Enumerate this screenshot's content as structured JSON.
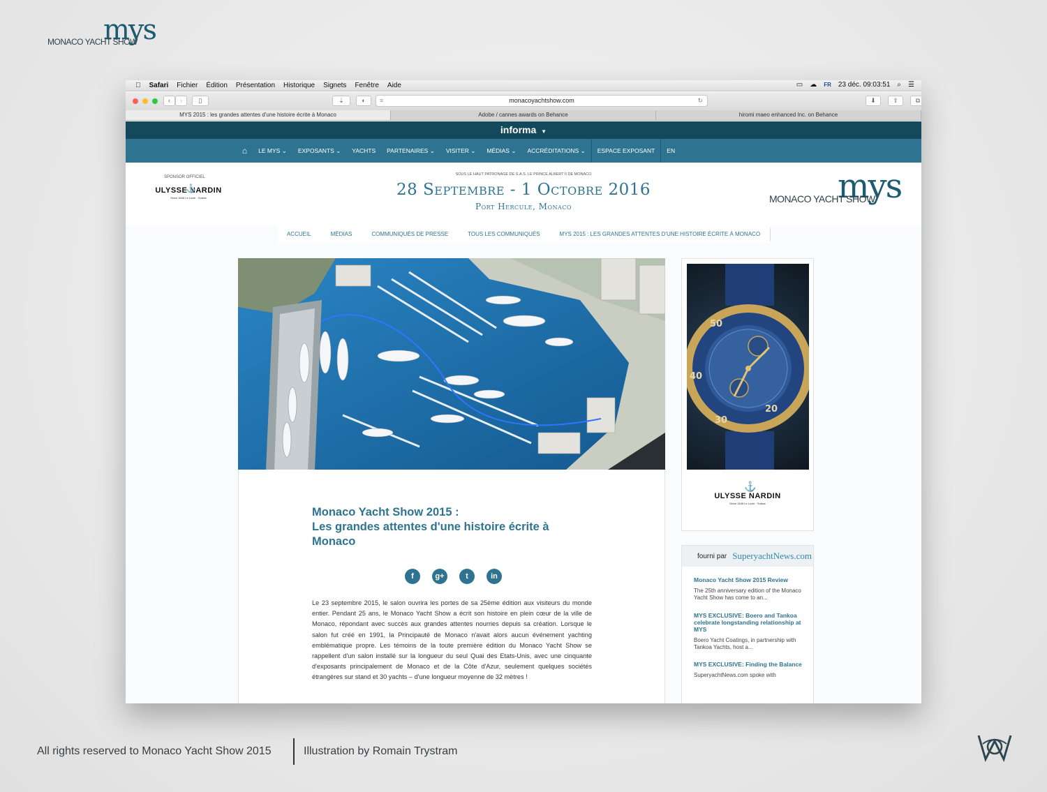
{
  "presentation": {
    "logo_script": "mys",
    "logo_text": "MONACO YACHT SHOW",
    "footer_left": "All rights reserved to Monaco Yacht Show 2015",
    "footer_right": "Illustration by Romain Trystram"
  },
  "menubar": {
    "items": [
      "Safari",
      "Fichier",
      "Édition",
      "Présentation",
      "Historique",
      "Signets",
      "Fenêtre",
      "Aide"
    ],
    "flag": "FR",
    "clock": "23 déc.  09:03:51"
  },
  "browser": {
    "url": "monacoyachtshow.com",
    "tabs": [
      "MYS 2015 : les grandes attentes d'une histoire écrite à Monaco",
      "Adobe / cannes awards on Behance",
      "hiromi maeo enhanced Inc. on Behance"
    ]
  },
  "site": {
    "brand_bar": "informa",
    "nav": [
      "LE MYS",
      "EXPOSANTS",
      "YACHTS",
      "PARTENAIRES",
      "VISITER",
      "MÉDIAS",
      "ACCRÉDITATIONS",
      "ESPACE EXPOSANT",
      "EN"
    ],
    "sponsor_label": "SPONSOR OFFICIEL",
    "sponsor_name": "ULYSSE NARDIN",
    "sponsor_tagline": "Since 1846   Le Locle · Suisse",
    "patronage": "SOUS LE HAUT PATRONAGE DE S.A.S. LE PRINCE ALBERT II DE MONACO",
    "dates": "28 Septembre - 1 Octobre 2016",
    "place": "Port Hercule, Monaco",
    "logo_script": "mys",
    "logo_text": "MONACO YACHT SHOW",
    "breadcrumb": [
      "ACCUEIL",
      "MÉDIAS",
      "COMMUNIQUÉS DE PRESSE",
      "TOUS LES COMMUNIQUÉS",
      "MYS 2015 : LES GRANDES ATTENTES D'UNE HISTOIRE ÉCRITE À MONACO"
    ]
  },
  "article": {
    "title_line1": "Monaco Yacht Show 2015 :",
    "title_line2": "Les grandes attentes d'une histoire écrite à Monaco",
    "social": [
      "f",
      "g+",
      "t",
      "in"
    ],
    "body": "Le 23 septembre 2015, le salon ouvrira les portes de sa 25ème édition aux visiteurs du monde entier. Pendant 25 ans, le Monaco Yacht Show a écrit son histoire en plein cœur de la ville de Monaco, répondant avec succès aux grandes attentes nourries depuis sa création. Lorsque le salon fut créé en 1991, la Principauté de Monaco n'avait alors aucun événement yachting emblématique propre. Les témoins de la toute première édition du Monaco Yacht Show se rappellent d'un salon installé sur la longueur du seul Quai des Etats-Unis, avec une cinquante d'exposants principalement de Monaco et de la Côte d'Azur, seulement quelques sociétés étrangères sur stand et 30 yachts – d'une longueur moyenne de 32 mètres !"
  },
  "sidebar": {
    "ad_brand": "ULYSSE NARDIN",
    "ad_tagline": "Since 1846   Le Locle · Suisse",
    "watch_numbers": [
      "50",
      "40",
      "30",
      "20"
    ],
    "news_provider_label": "fourni par",
    "news_provider": "SuperyachtNews.com",
    "news": [
      {
        "title": "Monaco Yacht Show 2015 Review",
        "desc": "The 25th anniversary edition of the Monaco Yacht Show has come to an..."
      },
      {
        "title": "MYS EXCLUSIVE: Boero and Tankoa celebrate longstanding relationship at MYS",
        "desc": "Boero Yacht Coatings, in partnership with Tankoa Yachts, host a..."
      },
      {
        "title": "MYS EXCLUSIVE: Finding the Balance",
        "desc": "SuperyachtNews.com spoke with"
      }
    ]
  },
  "colors": {
    "accent": "#2e7490",
    "dark": "#14495b",
    "sea": "#1f6fa8"
  }
}
